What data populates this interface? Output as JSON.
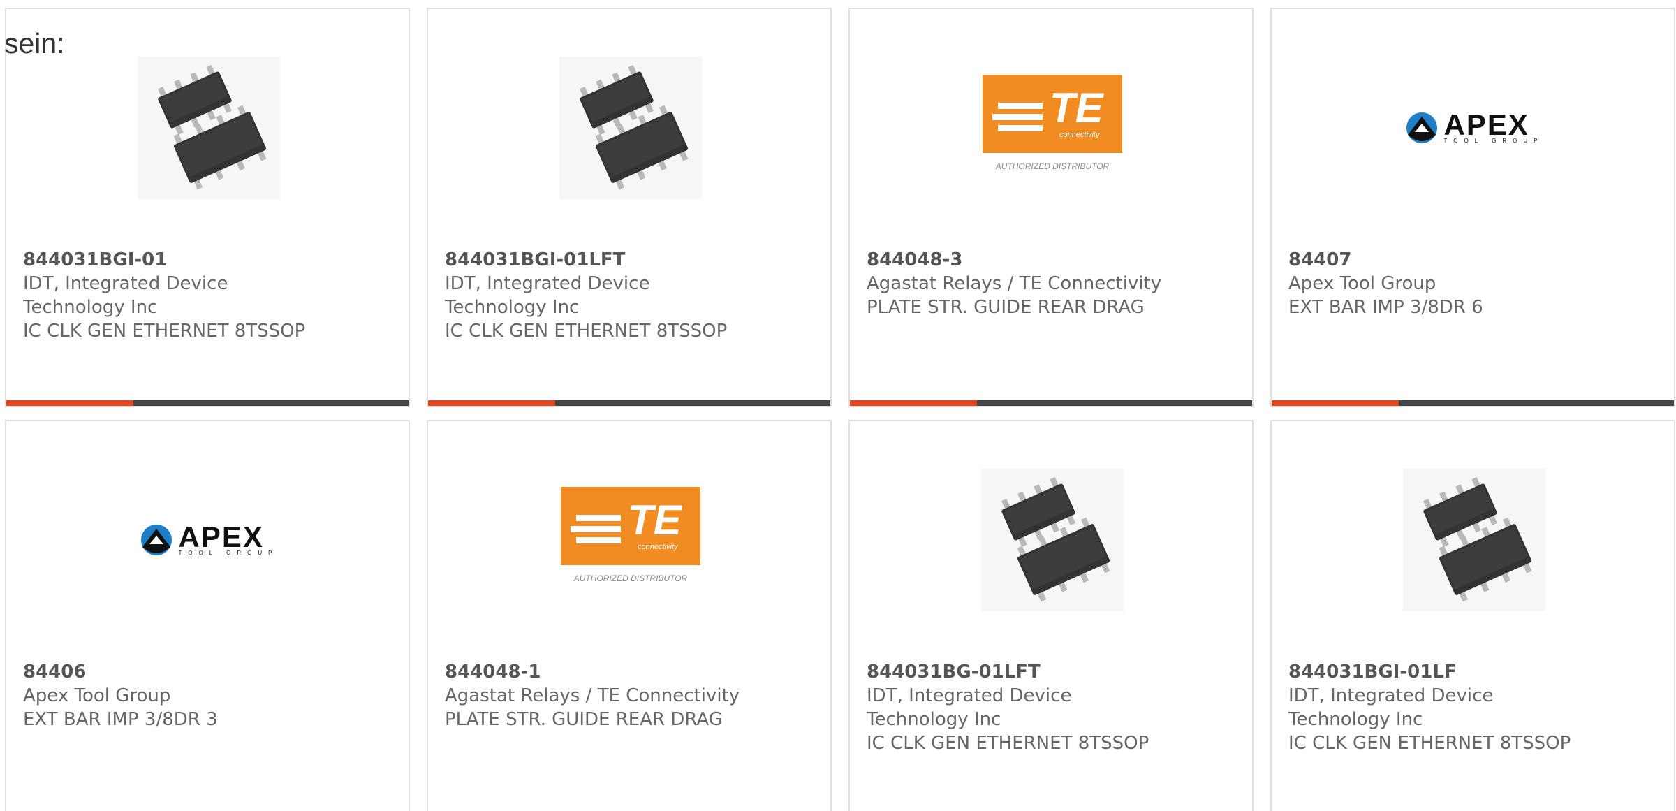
{
  "lead_text": "sein:",
  "colors": {
    "accent_bar": "#e8441d",
    "bar_dark": "#444444",
    "te_orange": "#f08c22"
  },
  "products": [
    {
      "part": "844031BGI-01",
      "maker_lines": [
        "IDT, Integrated Device",
        "Technology Inc"
      ],
      "description": "IC CLK GEN ETHERNET 8TSSOP",
      "image": "ic-chip-icon"
    },
    {
      "part": "844031BGI-01LFT",
      "maker_lines": [
        "IDT, Integrated Device",
        "Technology Inc"
      ],
      "description": "IC CLK GEN ETHERNET 8TSSOP",
      "image": "ic-chip-icon"
    },
    {
      "part": "844048-3",
      "maker_lines": [
        "Agastat Relays / TE Connectivity"
      ],
      "description": "PLATE STR. GUIDE REAR DRAG",
      "image": "te-logo",
      "logo_letters": "TE",
      "logo_sub": "connectivity",
      "logo_caption": "AUTHORIZED DISTRIBUTOR"
    },
    {
      "part": "84407",
      "maker_lines": [
        "Apex Tool Group"
      ],
      "description": "EXT BAR IMP 3/8DR 6",
      "image": "apex-logo",
      "logo_word": "APEX",
      "logo_tag": "TOOL GROUP"
    },
    {
      "part": "84406",
      "maker_lines": [
        "Apex Tool Group"
      ],
      "description": "EXT BAR IMP 3/8DR 3",
      "image": "apex-logo",
      "logo_word": "APEX",
      "logo_tag": "TOOL GROUP"
    },
    {
      "part": "844048-1",
      "maker_lines": [
        "Agastat Relays / TE Connectivity"
      ],
      "description": "PLATE STR. GUIDE REAR DRAG",
      "image": "te-logo",
      "logo_letters": "TE",
      "logo_sub": "connectivity",
      "logo_caption": "AUTHORIZED DISTRIBUTOR"
    },
    {
      "part": "844031BG-01LFT",
      "maker_lines": [
        "IDT, Integrated Device",
        "Technology Inc"
      ],
      "description": "IC CLK GEN ETHERNET 8TSSOP",
      "image": "ic-chip-icon"
    },
    {
      "part": "844031BGI-01LF",
      "maker_lines": [
        "IDT, Integrated Device",
        "Technology Inc"
      ],
      "description": "IC CLK GEN ETHERNET 8TSSOP",
      "image": "ic-chip-icon"
    }
  ]
}
